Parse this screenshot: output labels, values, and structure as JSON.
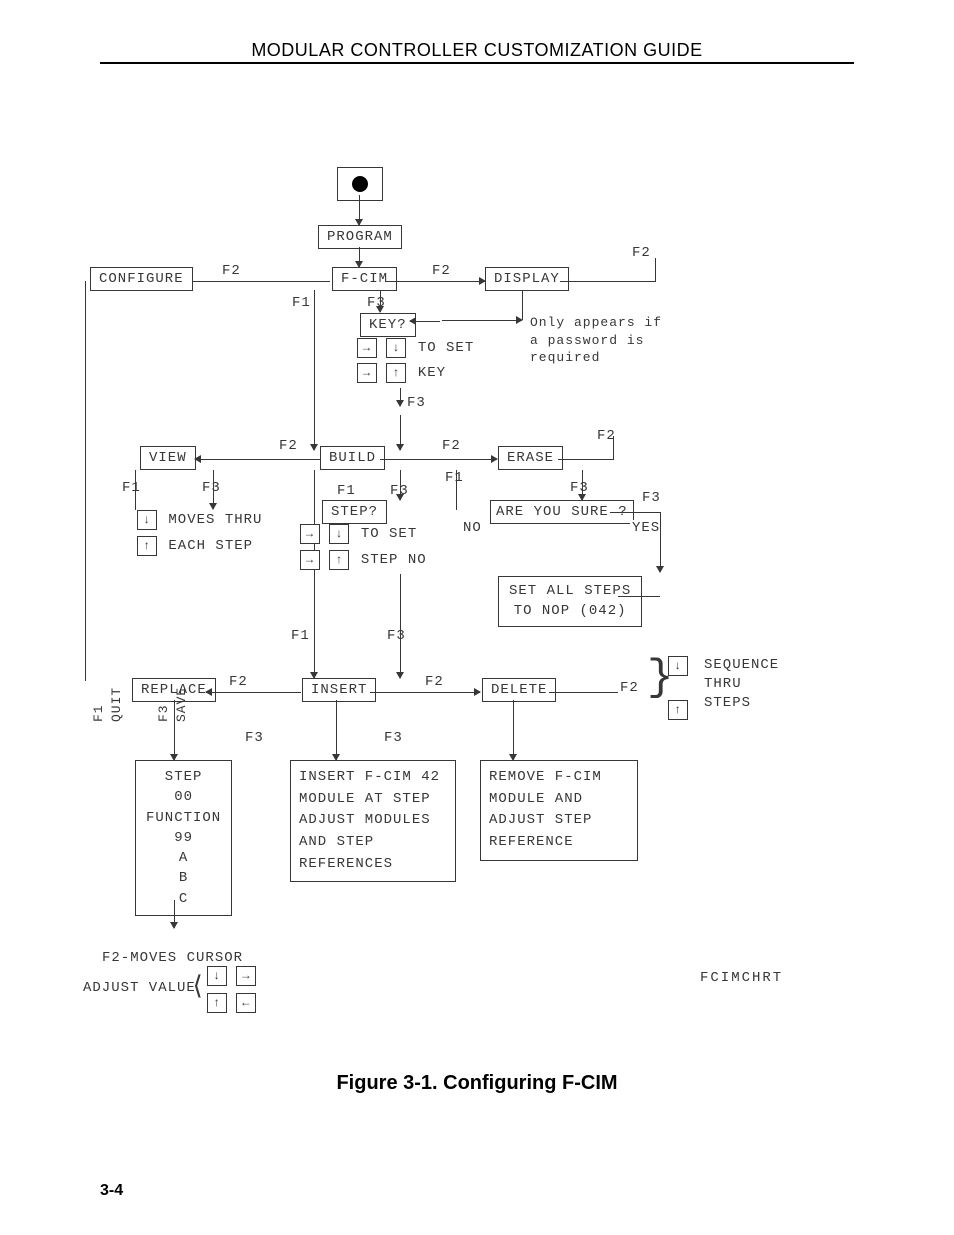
{
  "header": {
    "title": "MODULAR CONTROLLER CUSTOMIZATION GUIDE"
  },
  "caption": "Figure 3-1. Configuring F-CIM",
  "page_number": "3-4",
  "n": {
    "program": "PROGRAM",
    "fcim": "F-CIM",
    "configure": "CONFIGURE",
    "display": "DISPLAY",
    "key": "KEY?",
    "to_set": "TO SET",
    "key_set": "KEY",
    "view": "VIEW",
    "build": "BUILD",
    "erase": "ERASE",
    "moves_thru": "MOVES THRU",
    "each_step": "EACH STEP",
    "step": "STEP?",
    "to_set2": "TO SET",
    "step_no": "STEP NO",
    "sure": "ARE YOU SURE ?",
    "no": "NO",
    "yes": "YES",
    "set_all": "SET ALL STEPS\nTO NOP (042)",
    "replace": "REPLACE",
    "insert": "INSERT",
    "delete": "DELETE",
    "seq": "SEQUENCE\nTHRU\nSTEPS",
    "step_block": "STEP\n00\nFUNCTION\n99\nA\nB\nC",
    "insert_block": "INSERT F-CIM 42\nMODULE AT STEP\nADJUST MODULES\nAND STEP\nREFERENCES",
    "delete_block": "REMOVE F-CIM\nMODULE AND\nADJUST STEP\nREFERENCE",
    "cursor": "F2-MOVES CURSOR",
    "adjust": "ADJUST VALUE",
    "footer_code": "FCIMCHRT",
    "pw": "Only appears if\na password is\nrequired"
  },
  "k": {
    "f1": "F1",
    "f2": "F2",
    "f3": "F3",
    "f1quit": "F1\nQUIT",
    "f3save": "F3\nSAVE",
    "left": "←",
    "right": "→",
    "up": "↑",
    "down": "↓"
  }
}
